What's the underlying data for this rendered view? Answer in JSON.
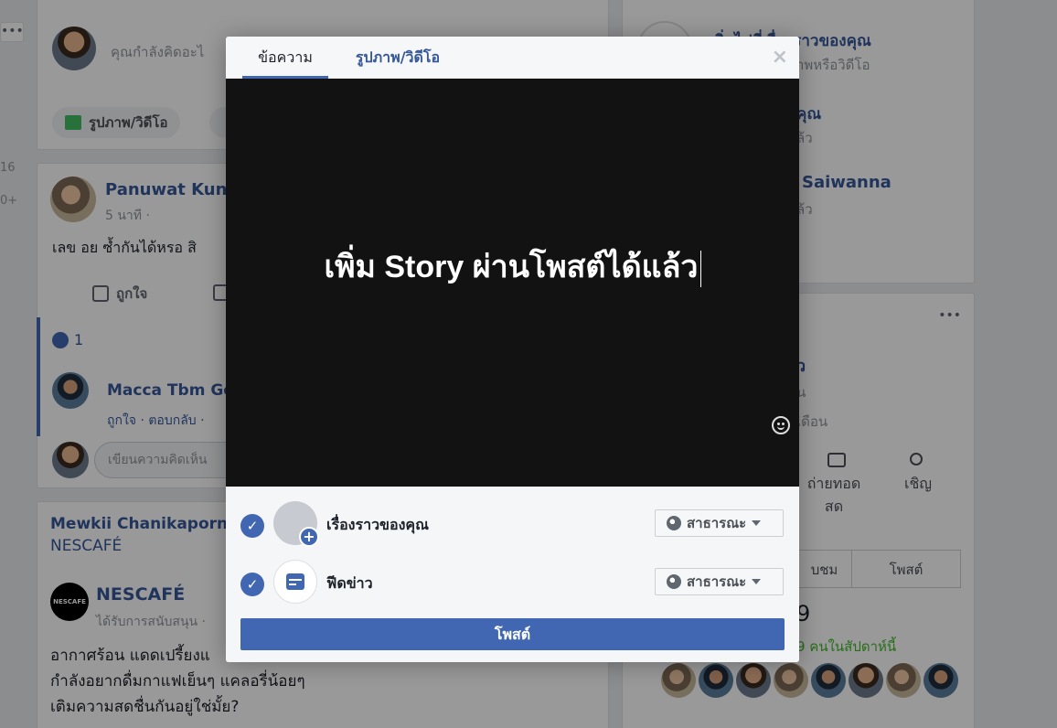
{
  "feed": {
    "compose_placeholder": "คุณกำลังคิดอะไ",
    "photo_video": "รูปภาพ/วิดีโอ",
    "post1": {
      "author": "Panuwat Kunc",
      "time": "5 นาที ·",
      "text": "เลข อย ซ้ำกันได้หรอ สิ",
      "like_label": "ถูกใจ",
      "like_count": "1"
    },
    "comment": {
      "author": "Macca Tbm Ge",
      "actions": "ถูกใจ · ตอบกลับ ·",
      "write_placeholder": "เขียนความคิดเห็น"
    },
    "post2": {
      "header": "Mewkii Chanikaporn,",
      "header2": "NESCAFÉ",
      "brand": "NESCAFÉ",
      "sponsored": "ได้รับการสนับสนุน ·",
      "lines": [
        "อากาศร้อน แดดเปรี้ยงแ",
        "กำลังอยากดื่มกาแฟเย็นๆ แคลอรี่น้อยๆ",
        "เติมความสดชื่นกันอยู่ใช่มั้ย?"
      ]
    },
    "left_numbers": [
      "16",
      "0+"
    ],
    "right": {
      "story_prompt": "เพิ่มไปที่เรื่องราวของคุณ",
      "story_sub": "าพหรือวิดีโอ",
      "friend1": "คุณ",
      "friend1_sub": "ล้ว",
      "friend2": "Saiwanna",
      "friend2_sub": "ล้ว",
      "page_title": "ว",
      "page_sub1": "น",
      "page_sub2": "เดือน",
      "live_label": "ถ่ายทอด สด",
      "invite_label": "เชิญ",
      "tab1": "บชม",
      "tab2": "โพสต์",
      "count_big": "9",
      "count_sub": "9 คนในสัปดาห์นี้"
    }
  },
  "modal": {
    "tabs": [
      "ข้อความ",
      "รูปภาพ/วิดีโอ"
    ],
    "close_glyph": "×",
    "story_text": "เพิ่ม Story ผ่านโพสต์ได้แล้ว",
    "back_glyph": "<",
    "destinations": [
      {
        "label": "เรื่องราวของคุณ",
        "privacy": "สาธารณะ"
      },
      {
        "label": "ฟีดข่าว",
        "privacy": "สาธารณะ"
      }
    ],
    "post_button": "โพสต์"
  },
  "colors": {
    "accent": "#4267b2",
    "swatches": [
      "#ffffff",
      "#c800ff",
      "#e8002d",
      "#7a3bbf",
      "#b05cff",
      "#e0354f",
      "#f8a42d",
      "#2a1330",
      "#2c2f36",
      "#3c1f5a",
      "#ff4b7c",
      "#233a7a",
      "#5a6bff",
      "#d9343b"
    ]
  }
}
